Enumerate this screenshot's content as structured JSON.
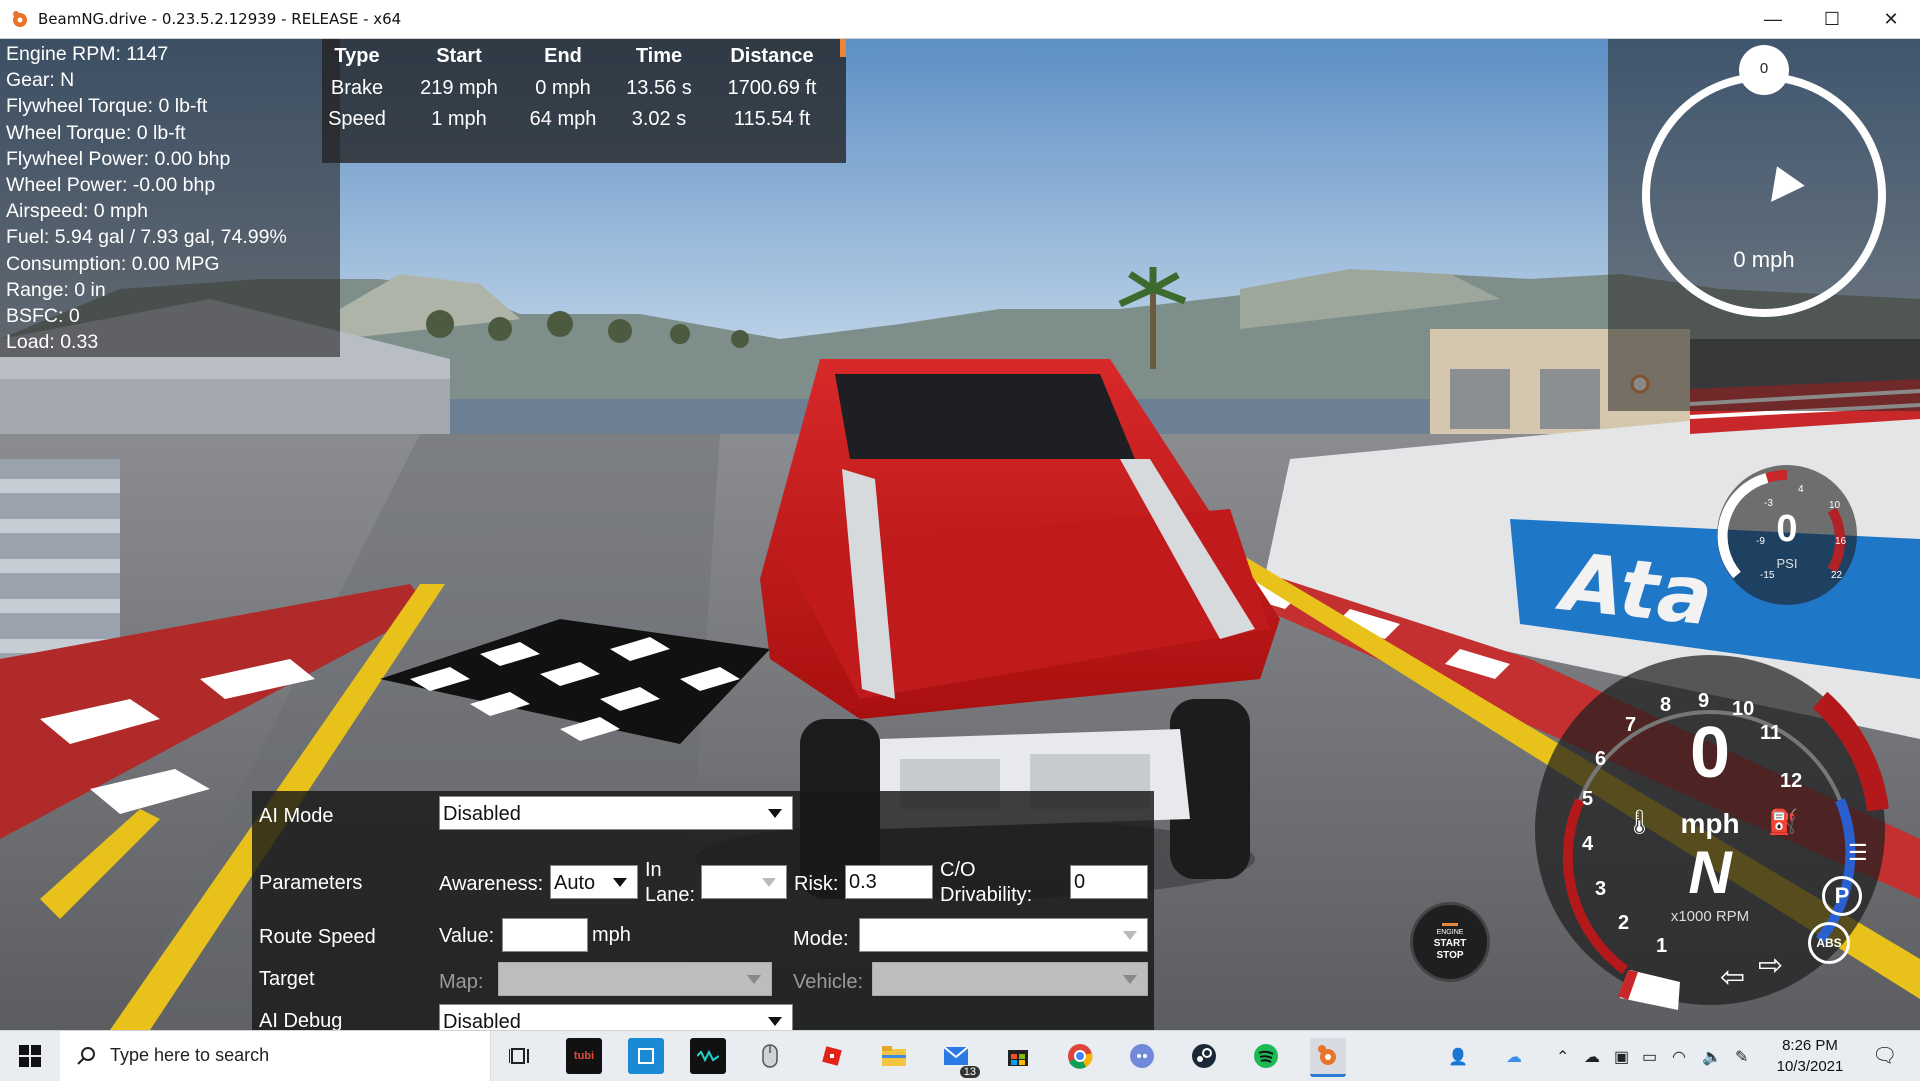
{
  "window": {
    "title": "BeamNG.drive - 0.23.5.2.12939 - RELEASE - x64",
    "minimize_glyph": "—",
    "maximize_glyph": "☐",
    "close_glyph": "✕"
  },
  "telemetry": {
    "lines": [
      "Engine RPM: 1147",
      "Gear: N",
      "Flywheel Torque: 0 lb-ft",
      "Wheel Torque: 0 lb-ft",
      "Flywheel Power: 0.00 bhp",
      "Wheel Power: -0.00 bhp",
      "Airspeed: 0 mph",
      "Fuel: 5.94 gal / 7.93 gal, 74.99%",
      "Consumption: 0.00 MPG",
      "Range: 0 in",
      "BSFC: 0",
      "Load: 0.33"
    ]
  },
  "drag_table": {
    "headers": [
      "Type",
      "Start",
      "End",
      "Time",
      "Distance"
    ],
    "rows": [
      [
        "Brake",
        "219 mph",
        "0 mph",
        "13.56 s",
        "1700.69 ft"
      ],
      [
        "Speed",
        "1 mph",
        "64 mph",
        "3.02 s",
        "115.54 ft"
      ]
    ]
  },
  "speed_widget": {
    "heading_value": "0",
    "speed": "0 mph"
  },
  "boost_gauge": {
    "value": "0",
    "unit": "PSI",
    "ticks": [
      "-3",
      "4",
      "10",
      "-9",
      "16",
      "-15",
      "22"
    ]
  },
  "tacho": {
    "numbers": [
      "1",
      "2",
      "3",
      "4",
      "5",
      "6",
      "7",
      "8",
      "9",
      "10",
      "11",
      "12"
    ],
    "speed_value": "0",
    "speed_unit": "mph",
    "gear": "N",
    "rpm_label": "x1000 RPM",
    "indicators": [
      "P",
      "ABS"
    ]
  },
  "engine_button": {
    "line1": "ENGINE",
    "line2": "START",
    "line3": "STOP"
  },
  "ai_panel": {
    "ai_mode_label": "AI Mode",
    "ai_mode_value": "Disabled",
    "parameters_label": "Parameters",
    "awareness_label": "Awareness:",
    "awareness_value": "Auto",
    "in_lane_label_1": "In",
    "in_lane_label_2": "Lane:",
    "in_lane_value": "",
    "risk_label": "Risk:",
    "risk_value": "0.3",
    "co_label_1": "C/O",
    "co_label_2": "Drivability:",
    "co_value": "0",
    "route_speed_label": "Route Speed",
    "value_label": "Value:",
    "value_value": "",
    "mph_label": "mph",
    "mode_label": "Mode:",
    "mode_value": "",
    "target_label": "Target",
    "map_label": "Map:",
    "map_value": "",
    "vehicle_label": "Vehicle:",
    "vehicle_value": "",
    "ai_debug_label": "AI Debug",
    "ai_debug_value": "Disabled"
  },
  "taskbar": {
    "search_placeholder": "Type here to search",
    "apps": [
      "task-view",
      "tubi",
      "store-note",
      "wave-app",
      "mouse-app",
      "roblox",
      "file-explorer",
      "mail",
      "store",
      "chrome",
      "discord",
      "steam",
      "spotify",
      "beamng"
    ],
    "tubi_label": "tubi",
    "mail_badge": "13",
    "time": "8:26 PM",
    "date": "10/3/2021"
  },
  "colors": {
    "car_red": "#c8171b",
    "sky": "#8fb3d6",
    "accent_orange": "#e8873a"
  }
}
